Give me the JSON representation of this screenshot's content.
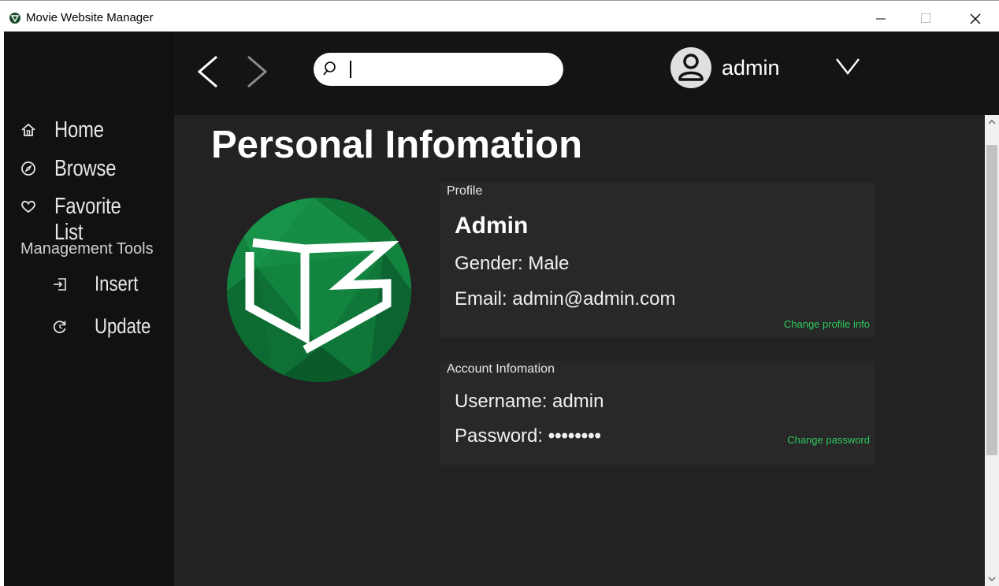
{
  "window": {
    "title": "Movie Website Manager",
    "icon": "app-logo-icon"
  },
  "sidebar": {
    "items": [
      {
        "label": "Home",
        "icon": "home-icon"
      },
      {
        "label": "Browse",
        "icon": "compass-icon"
      },
      {
        "label": "Favorite List",
        "icon": "heart-icon"
      }
    ],
    "section_label": "Management Tools",
    "tools": [
      {
        "label": "Insert",
        "icon": "insert-icon"
      },
      {
        "label": "Update",
        "icon": "update-icon"
      }
    ]
  },
  "topbar": {
    "search_value": "",
    "user_name": "admin"
  },
  "main": {
    "page_title": "Personal Infomation",
    "profile": {
      "label": "Profile",
      "name": "Admin",
      "gender": "Gender: Male",
      "email": "Email: admin@admin.com",
      "change_link": "Change profile info"
    },
    "account": {
      "label": "Account Infomation",
      "username": "Username: admin",
      "password_label": "Password:",
      "password_mask": "••••••••",
      "change_link": "Change password"
    }
  },
  "colors": {
    "background": "#222222",
    "sidebar": "#111111",
    "accent_green": "#2ec95f",
    "logo_green": "#0f7a3a"
  }
}
